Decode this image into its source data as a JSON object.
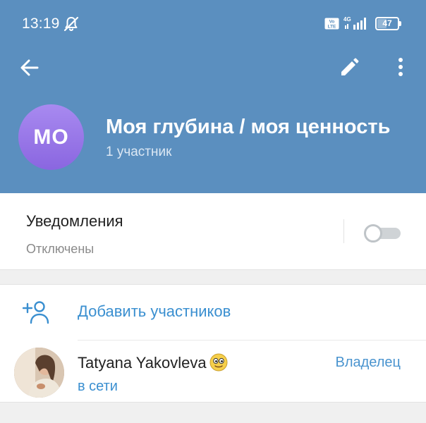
{
  "status_bar": {
    "time": "13:19",
    "battery_level": "47",
    "network": "4G",
    "volte": "Vo LTE"
  },
  "toolbar": {
    "back_icon": "arrow-left-icon",
    "edit_icon": "pencil-icon",
    "more_icon": "more-vertical-icon"
  },
  "group": {
    "avatar_initials": "МО",
    "avatar_color": "#9b7be9",
    "title": "Моя глубина / моя ценность",
    "members_count": "1 участник"
  },
  "notifications": {
    "label": "Уведомления",
    "status": "Отключены",
    "enabled": false
  },
  "members": {
    "add_label": "Добавить участников",
    "list": [
      {
        "name": "Tatyana Yakovleva",
        "status": "в сети",
        "role": "Владелец"
      }
    ]
  },
  "colors": {
    "header": "#5b8fbf",
    "accent": "#3a8fd0"
  }
}
